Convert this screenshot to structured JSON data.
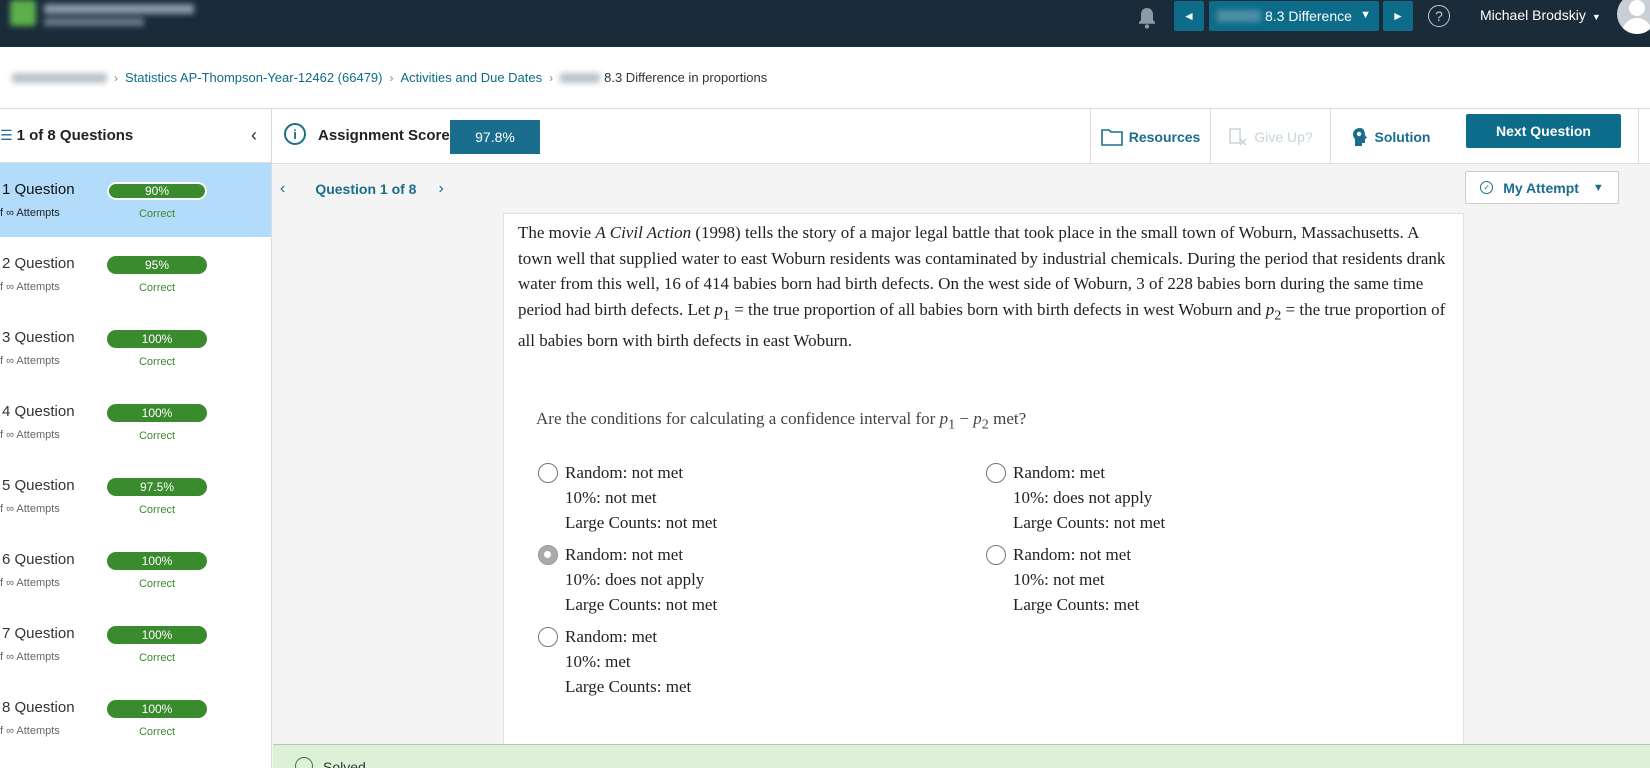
{
  "topbar": {
    "course_select": "8.3 Difference",
    "username": "Michael Brodskiy",
    "help_glyph": "?"
  },
  "breadcrumb": {
    "course": "Statistics AP-Thompson-Year-12462 (66479)",
    "activities": "Activities and Due Dates",
    "current": "8.3 Difference in proportions"
  },
  "sidebar": {
    "title": "1 of 8 Questions",
    "questions": [
      {
        "label": "1 Question",
        "attempts": "f ∞ Attempts",
        "score": "90%",
        "status": "Correct"
      },
      {
        "label": "2 Question",
        "attempts": "f ∞ Attempts",
        "score": "95%",
        "status": "Correct"
      },
      {
        "label": "3 Question",
        "attempts": "f ∞ Attempts",
        "score": "100%",
        "status": "Correct"
      },
      {
        "label": "4 Question",
        "attempts": "f ∞ Attempts",
        "score": "100%",
        "status": "Correct"
      },
      {
        "label": "5 Question",
        "attempts": "f ∞ Attempts",
        "score": "97.5%",
        "status": "Correct"
      },
      {
        "label": "6 Question",
        "attempts": "f ∞ Attempts",
        "score": "100%",
        "status": "Correct"
      },
      {
        "label": "7 Question",
        "attempts": "f ∞ Attempts",
        "score": "100%",
        "status": "Correct"
      },
      {
        "label": "8 Question",
        "attempts": "f ∞ Attempts",
        "score": "100%",
        "status": "Correct"
      }
    ]
  },
  "toolbar": {
    "score_label": "Assignment Score:",
    "score_value": "97.8%",
    "resources": "Resources",
    "give_up": "Give Up?",
    "solution": "Solution",
    "next": "Next Question"
  },
  "main": {
    "question_nav": "Question 1 of 8",
    "my_attempt": "My Attempt",
    "stem_a": "The movie ",
    "stem_title": "A Civil Action",
    "stem_b": " (1998) tells the story of a major legal battle that took place in the small town of Woburn, Massachusetts. A town well that supplied water to east Woburn residents was contaminated by industrial chemicals. During the period that residents drank water from this well, 16 of 414 babies born had birth defects. On the west side of Woburn, 3 of 228 babies born during the same time period had birth defects. Let ",
    "p1": "p",
    "p1_sub": "1",
    "stem_c": " = the true proportion of all babies born with birth defects in west Woburn and ",
    "p2": "p",
    "p2_sub": "2",
    "stem_d": " = the true proportion of all babies born with birth defects in east Woburn.",
    "prompt_a": "Are the conditions for calculating a confidence interval for ",
    "prompt_expr_a": "p",
    "prompt_sub_a": "1",
    "prompt_minus": " − ",
    "prompt_expr_b": "p",
    "prompt_sub_b": "2",
    "prompt_b": " met?",
    "choices": [
      {
        "line1": "Random: not met",
        "line2": "10%: not met",
        "line3": "Large Counts: not met",
        "selected": false
      },
      {
        "line1": "Random: met",
        "line2": "10%: does not apply",
        "line3": "Large Counts: not met",
        "selected": false
      },
      {
        "line1": "Random: not met",
        "line2": "10%: does not apply",
        "line3": "Large Counts: not met",
        "selected": true
      },
      {
        "line1": "Random: not met",
        "line2": "10%: not met",
        "line3": "Large Counts: met",
        "selected": false
      },
      {
        "line1": "Random: met",
        "line2": "10%: met",
        "line3": "Large Counts: met",
        "selected": false
      }
    ],
    "solved": "Solved"
  },
  "colors": {
    "topbar": "#1a2b3a",
    "accent": "#0c6c8a",
    "correct": "#3a8a2e",
    "active_row": "#b3dcfb"
  }
}
